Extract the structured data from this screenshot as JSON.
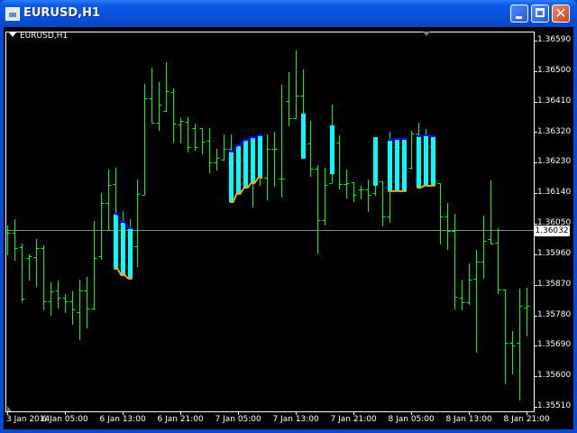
{
  "window": {
    "title": "EURUSD,H1",
    "minimize_icon": "minimize-icon",
    "maximize_icon": "maximize-icon",
    "close_icon": "close-icon"
  },
  "chart": {
    "symbol_label": "EURUSD,H1",
    "current_price": "1.36032"
  },
  "colors": {
    "bar": "#00ff00",
    "indicator_fill": "#00ffff",
    "indicator_top": "#0000ff",
    "indicator_bottom": "#ffa500",
    "price_line": "#778899",
    "background": "#000000"
  },
  "chart_data": {
    "type": "ohlc",
    "symbol": "EURUSD",
    "timeframe": "H1",
    "ylim": [
      1.3551,
      1.3659
    ],
    "price_ticks": [
      "1.36590",
      "1.36500",
      "1.36410",
      "1.36320",
      "1.36230",
      "1.36140",
      "1.36050",
      "1.35960",
      "1.35870",
      "1.35780",
      "1.35690",
      "1.35600",
      "1.35510"
    ],
    "time_labels": [
      {
        "bar": 0,
        "label": "3 Jan 2014"
      },
      {
        "bar": 8,
        "label": "6 Jan 05:00"
      },
      {
        "bar": 16,
        "label": "6 Jan 13:00"
      },
      {
        "bar": 24,
        "label": "6 Jan 21:00"
      },
      {
        "bar": 32,
        "label": "7 Jan 05:00"
      },
      {
        "bar": 40,
        "label": "7 Jan 13:00"
      },
      {
        "bar": 48,
        "label": "7 Jan 21:00"
      },
      {
        "bar": 56,
        "label": "8 Jan 05:00"
      },
      {
        "bar": 64,
        "label": "8 Jan 13:00"
      },
      {
        "bar": 72,
        "label": "8 Jan 21:00"
      }
    ],
    "ohlc": [
      [
        1.36023,
        1.36045,
        1.35957,
        1.36023
      ],
      [
        1.36023,
        1.36063,
        1.35941,
        1.35978
      ],
      [
        1.35981,
        1.35991,
        1.35819,
        1.35829
      ],
      [
        1.35949,
        1.3596,
        1.35882,
        1.35954
      ],
      [
        1.35952,
        1.36005,
        1.35864,
        1.35978
      ],
      [
        1.35978,
        1.35986,
        1.35795,
        1.35821
      ],
      [
        1.35821,
        1.35877,
        1.35779,
        1.35851
      ],
      [
        1.35853,
        1.35882,
        1.358,
        1.35832
      ],
      [
        1.35832,
        1.35843,
        1.35787,
        1.35821
      ],
      [
        1.35821,
        1.35851,
        1.35752,
        1.35797
      ],
      [
        1.35789,
        1.35885,
        1.35707,
        1.35853
      ],
      [
        1.35853,
        1.35893,
        1.35741,
        1.358
      ],
      [
        1.358,
        1.36058,
        1.35795,
        1.35949
      ],
      [
        1.35954,
        1.3614,
        1.35944,
        1.36111
      ],
      [
        1.36111,
        1.3621,
        1.36031,
        1.36164
      ],
      [
        1.36167,
        1.36215,
        1.35917,
        1.3605
      ],
      [
        1.3605,
        1.36087,
        1.35898,
        1.36018
      ],
      [
        1.36015,
        1.36063,
        1.35888,
        1.35984
      ],
      [
        1.35984,
        1.3618,
        1.35922,
        1.36138
      ],
      [
        1.36135,
        1.36462,
        1.36135,
        1.3642
      ],
      [
        1.3642,
        1.3651,
        1.36348,
        1.36348
      ],
      [
        1.36348,
        1.36468,
        1.36324,
        1.36401
      ],
      [
        1.36383,
        1.36526,
        1.3638,
        1.36441
      ],
      [
        1.36438,
        1.36449,
        1.36289,
        1.36345
      ],
      [
        1.36343,
        1.36361,
        1.36287,
        1.36353
      ],
      [
        1.36351,
        1.36364,
        1.3626,
        1.36276
      ],
      [
        1.36332,
        1.36345,
        1.36265,
        1.36276
      ],
      [
        1.36332,
        1.36332,
        1.36255,
        1.36292
      ],
      [
        1.36295,
        1.36332,
        1.36199,
        1.36231
      ],
      [
        1.36231,
        1.36271,
        1.36207,
        1.36244
      ],
      [
        1.36239,
        1.36313,
        1.36236,
        1.36271
      ],
      [
        1.36271,
        1.36313,
        1.36114,
        1.36239
      ],
      [
        1.36239,
        1.36281,
        1.36138,
        1.36239
      ],
      [
        1.36239,
        1.36297,
        1.36156,
        1.36207
      ],
      [
        1.36207,
        1.36305,
        1.36098,
        1.36186
      ],
      [
        1.36188,
        1.36311,
        1.36162,
        1.36186
      ],
      [
        1.36186,
        1.36313,
        1.36119,
        1.36271
      ],
      [
        1.36271,
        1.36321,
        1.36159,
        1.36271
      ],
      [
        1.36183,
        1.3646,
        1.36127,
        1.36183
      ],
      [
        1.36412,
        1.36497,
        1.36337,
        1.36361
      ],
      [
        1.36361,
        1.36561,
        1.36359,
        1.36428
      ],
      [
        1.36428,
        1.36505,
        1.36242,
        1.36284
      ],
      [
        1.36287,
        1.36353,
        1.36188,
        1.36212
      ],
      [
        1.36212,
        1.36223,
        1.35962,
        1.36061
      ],
      [
        1.36061,
        1.36215,
        1.36045,
        1.36164
      ],
      [
        1.3617,
        1.36401,
        1.3617,
        1.36295
      ],
      [
        1.36289,
        1.36311,
        1.36151,
        1.36167
      ],
      [
        1.36167,
        1.3621,
        1.36124,
        1.3617
      ],
      [
        1.36172,
        1.3617,
        1.36114,
        1.36135
      ],
      [
        1.36151,
        1.36162,
        1.36122,
        1.36151
      ],
      [
        1.36151,
        1.3618,
        1.36085,
        1.36135
      ],
      [
        1.3614,
        1.36305,
        1.36132,
        1.36175
      ],
      [
        1.36175,
        1.36175,
        1.36042,
        1.36071
      ],
      [
        1.36071,
        1.36321,
        1.36053,
        1.36276
      ],
      [
        1.36276,
        1.363,
        1.36146,
        1.36276
      ],
      [
        1.36276,
        1.363,
        1.36146,
        1.36215
      ],
      [
        1.36215,
        1.36324,
        1.3621,
        1.36316
      ],
      [
        1.36316,
        1.36348,
        1.36156,
        1.36292
      ],
      [
        1.36292,
        1.36329,
        1.36162,
        1.36279
      ],
      [
        1.36279,
        1.36308,
        1.36162,
        1.36172
      ],
      [
        1.3617,
        1.3617,
        1.35989,
        1.36071
      ],
      [
        1.36071,
        1.36111,
        1.35973,
        1.36029
      ],
      [
        1.36029,
        1.36079,
        1.35797,
        1.35835
      ],
      [
        1.35832,
        1.35885,
        1.35795,
        1.35819
      ],
      [
        1.35819,
        1.35933,
        1.35811,
        1.35885
      ],
      [
        1.35888,
        1.35973,
        1.3567,
        1.35938
      ],
      [
        1.35938,
        1.36074,
        1.35888,
        1.35999
      ],
      [
        1.36005,
        1.36178,
        1.35989,
        1.35991
      ],
      [
        1.35994,
        1.36037,
        1.35843,
        1.35856
      ],
      [
        1.35856,
        1.35856,
        1.35577,
        1.35699
      ],
      [
        1.35699,
        1.35733,
        1.35606,
        1.35691
      ],
      [
        1.35699,
        1.35858,
        1.35529,
        1.35808
      ],
      [
        1.35803,
        1.35861,
        1.35718,
        1.35808
      ]
    ],
    "indicator": [
      {
        "bar": 15,
        "top": 1.36079,
        "bottom": 1.35917
      },
      {
        "bar": 16,
        "top": 1.36055,
        "bottom": 1.35898
      },
      {
        "bar": 17,
        "top": 1.36037,
        "bottom": 1.35888
      },
      {
        "bar": 31,
        "top": 1.36263,
        "bottom": 1.36114
      },
      {
        "bar": 32,
        "top": 1.36281,
        "bottom": 1.36138
      },
      {
        "bar": 33,
        "top": 1.36297,
        "bottom": 1.36156
      },
      {
        "bar": 34,
        "top": 1.36305,
        "bottom": 1.3617
      },
      {
        "bar": 35,
        "top": 1.36311,
        "bottom": 1.36186
      },
      {
        "bar": 41,
        "top": 1.36375,
        "bottom": 1.36242
      },
      {
        "bar": 45,
        "top": 1.3634,
        "bottom": 1.36196
      },
      {
        "bar": 51,
        "top": 1.36305,
        "bottom": 1.36162
      },
      {
        "bar": 53,
        "top": 1.36297,
        "bottom": 1.36146
      },
      {
        "bar": 54,
        "top": 1.363,
        "bottom": 1.36146
      },
      {
        "bar": 55,
        "top": 1.363,
        "bottom": 1.36146
      },
      {
        "bar": 57,
        "top": 1.36308,
        "bottom": 1.36156
      },
      {
        "bar": 58,
        "top": 1.36311,
        "bottom": 1.36162
      },
      {
        "bar": 59,
        "top": 1.36308,
        "bottom": 1.36162
      }
    ],
    "current_price": 1.36032
  }
}
